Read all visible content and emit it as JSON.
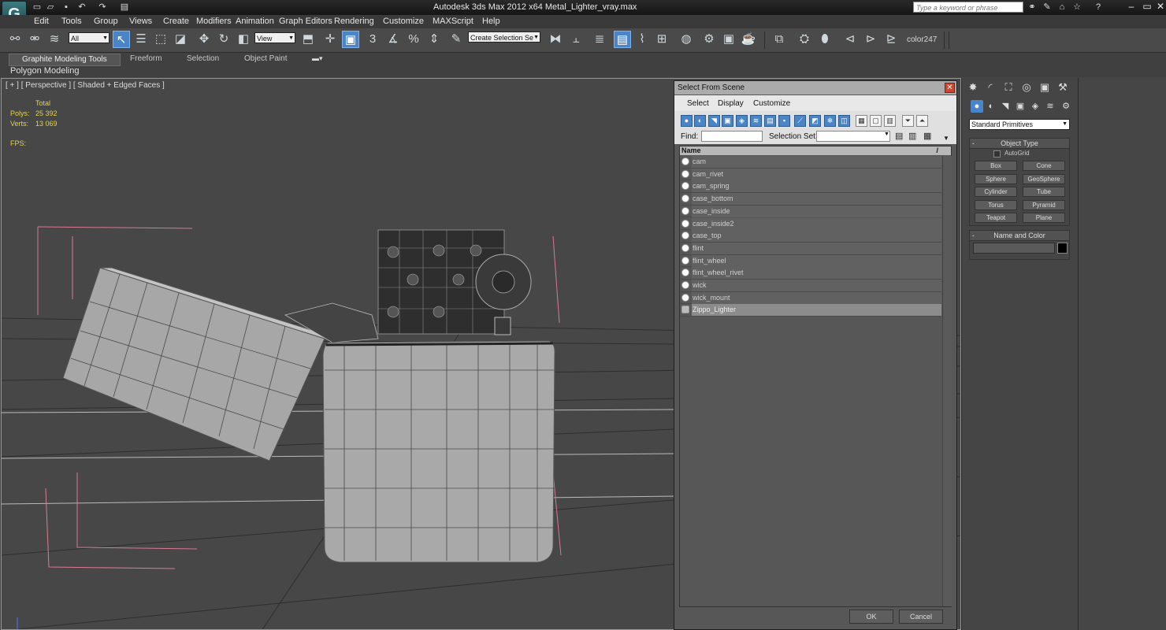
{
  "window": {
    "title": "Autodesk 3ds Max  2012 x64      Metal_Lighter_vray.max",
    "search_placeholder": "Type a keyword or phrase"
  },
  "menu": [
    "Edit",
    "Tools",
    "Group",
    "Views",
    "Create",
    "Modifiers",
    "Animation",
    "Graph Editors",
    "Rendering",
    "Customize",
    "MAXScript",
    "Help"
  ],
  "toolbar": {
    "filter_value": "All",
    "refcoord_value": "View",
    "snap_label": "3",
    "selection_set_placeholder": "Create Selection Se",
    "color_label": "color247"
  },
  "ribbon": {
    "tabs": [
      "Graphite Modeling Tools",
      "Freeform",
      "Selection",
      "Object Paint"
    ],
    "panel_label": "Polygon Modeling"
  },
  "viewport": {
    "label": "[ + ] [ Perspective ] [ Shaded + Edged Faces ]",
    "stats": {
      "total_label": "Total",
      "polys_label": "Polys:",
      "polys_value": "25 392",
      "verts_label": "Verts:",
      "verts_value": "13 069",
      "fps_label": "FPS:"
    }
  },
  "dialog": {
    "title": "Select From Scene",
    "menu": [
      "Select",
      "Display",
      "Customize"
    ],
    "find_label": "Find:",
    "selection_set_label": "Selection Set:",
    "column_header": "Name",
    "items": [
      "cam",
      "cam_rivet",
      "cam_spring",
      "case_bottom",
      "case_inside",
      "case_inside2",
      "case_top",
      "flint",
      "flint_wheel",
      "flint_wheel_rivet",
      "wick",
      "wick_mount",
      "Zippo_Lighter"
    ],
    "selected_item": "Zippo_Lighter",
    "ok_label": "OK",
    "cancel_label": "Cancel"
  },
  "command_panel": {
    "category": "Standard Primitives",
    "object_type_title": "Object Type",
    "autogrid_label": "AutoGrid",
    "primitives": [
      "Box",
      "Cone",
      "Sphere",
      "GeoSphere",
      "Cylinder",
      "Tube",
      "Torus",
      "Pyramid",
      "Teapot",
      "Plane"
    ],
    "name_color_title": "Name and Color",
    "swatch_color": "#000000"
  },
  "colors": {
    "accent_blue": "#4a86c7",
    "viewport_border": "#b59a3c",
    "stat_yellow": "#e6d34a",
    "helper_pink": "#d77a93"
  }
}
